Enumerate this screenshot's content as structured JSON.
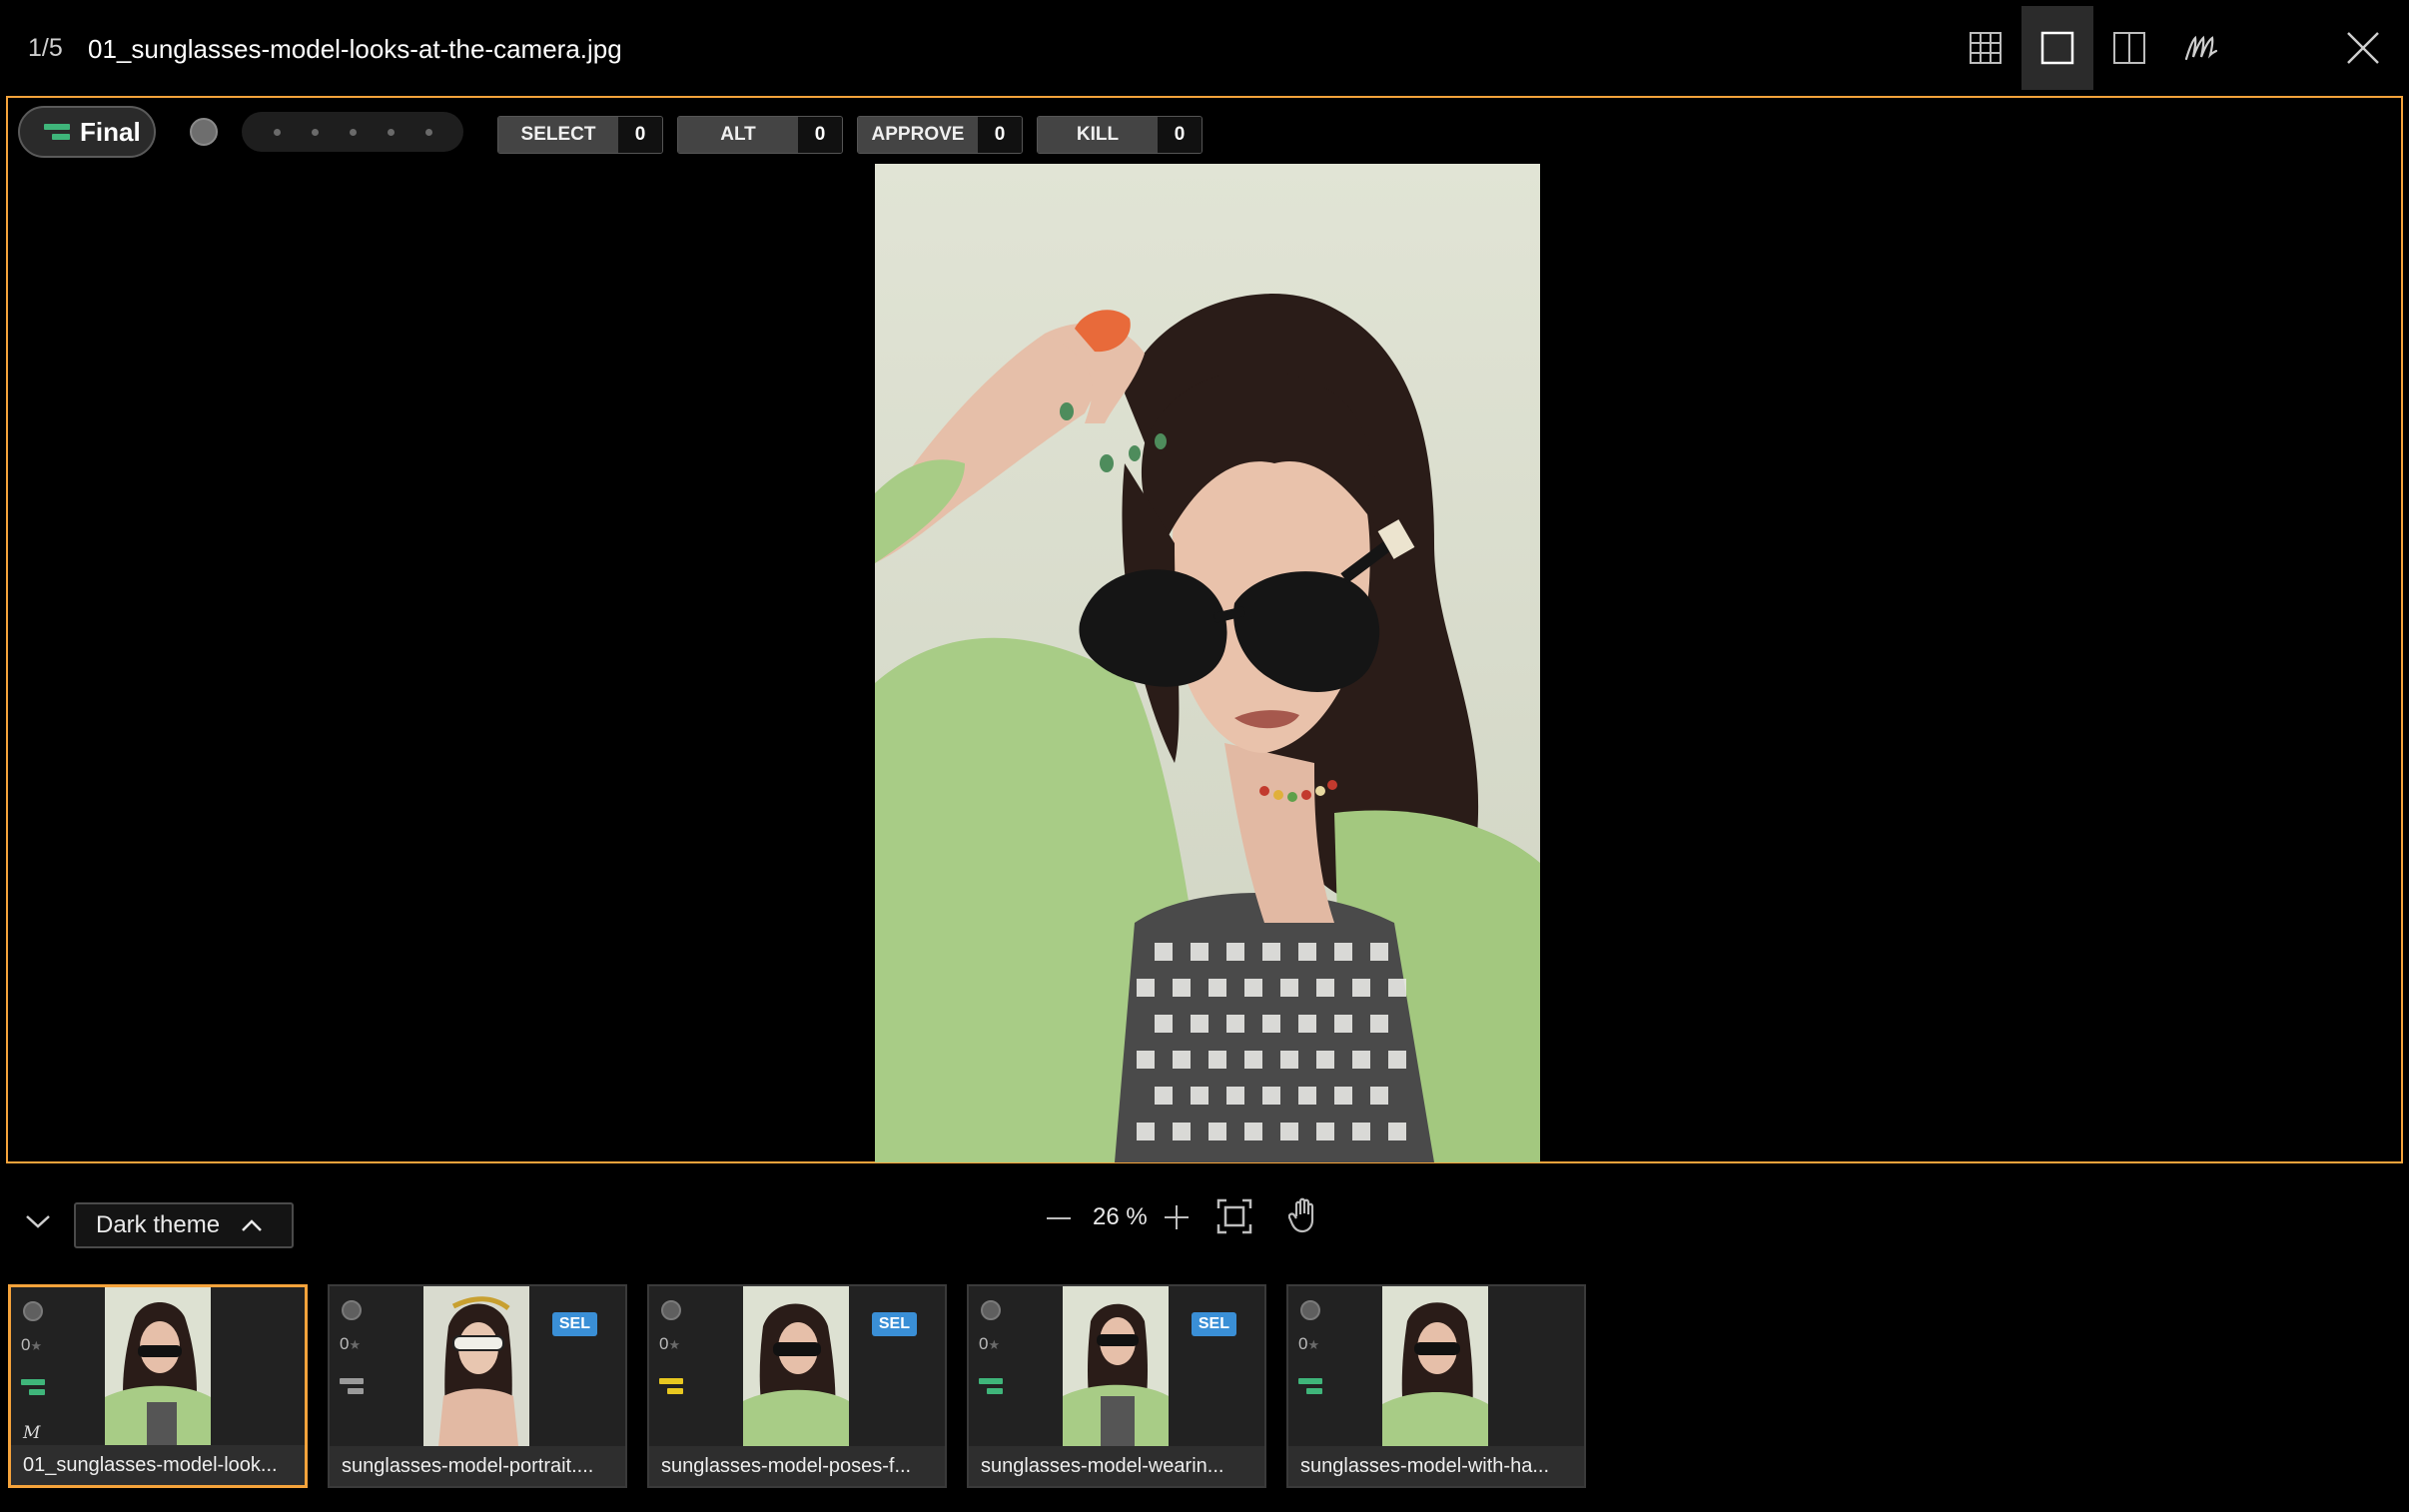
{
  "header": {
    "counter": "1/5",
    "filename": "01_sunglasses-model-looks-at-the-camera.jpg",
    "view_buttons": [
      {
        "icon": "grid-view-icon",
        "active": false
      },
      {
        "icon": "single-view-icon",
        "active": true
      },
      {
        "icon": "compare-view-icon",
        "active": false
      },
      {
        "icon": "signature-m-icon",
        "active": false
      }
    ],
    "close_icon": "close-icon"
  },
  "toolbar": {
    "final_label": "Final",
    "final_color": "#3fb57a",
    "tags": [
      {
        "label": "SELECT",
        "count": "0"
      },
      {
        "label": "ALT",
        "count": "0"
      },
      {
        "label": "APPROVE",
        "count": "0"
      },
      {
        "label": "KILL",
        "count": "0"
      }
    ]
  },
  "bottom": {
    "theme_label": "Dark theme",
    "zoom": "26 %"
  },
  "filmstrip": [
    {
      "name": "01_sunglasses-model-look...",
      "rating": "0",
      "badge": "",
      "status_color": "#3fb57a",
      "current": true,
      "mark": "M"
    },
    {
      "name": "sunglasses-model-portrait....",
      "rating": "0",
      "badge": "SEL",
      "status_color": "#9a9a9a",
      "current": false,
      "mark": ""
    },
    {
      "name": "sunglasses-model-poses-f...",
      "rating": "0",
      "badge": "SEL",
      "status_color": "#e8c820",
      "current": false,
      "mark": ""
    },
    {
      "name": "sunglasses-model-wearin...",
      "rating": "0",
      "badge": "SEL",
      "status_color": "#3fb57a",
      "current": false,
      "mark": ""
    },
    {
      "name": "sunglasses-model-with-ha...",
      "rating": "0",
      "badge": "",
      "status_color": "#3fb57a",
      "current": false,
      "mark": ""
    }
  ],
  "colors": {
    "accent": "#f5a33b",
    "badge_blue": "#3a8fd6"
  }
}
